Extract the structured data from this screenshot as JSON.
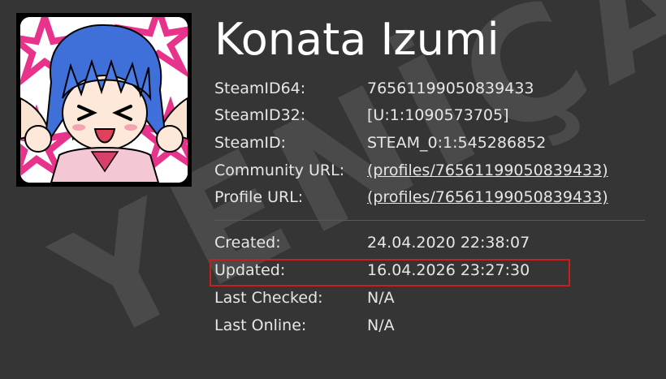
{
  "profile": {
    "name": "Konata Izumi",
    "avatar_description": "anime-avatar"
  },
  "watermark": "YENİÇAĞ",
  "details": [
    {
      "label": "SteamID64:",
      "value": "76561199050839433",
      "link": false
    },
    {
      "label": "SteamID32:",
      "value": "[U:1:1090573705]",
      "link": false
    },
    {
      "label": "SteamID:",
      "value": "STEAM_0:1:545286852",
      "link": false
    },
    {
      "label": "Community URL:",
      "value": "(profiles/76561199050839433)",
      "link": true
    },
    {
      "label": "Profile URL:",
      "value": "(profiles/76561199050839433)",
      "link": true
    }
  ],
  "activity": [
    {
      "label": "Created:",
      "value": "24.04.2020 22:38:07"
    },
    {
      "label": "Updated:",
      "value": "16.04.2026 23:27:30",
      "highlighted": true
    },
    {
      "label": "Last Checked:",
      "value": "N/A"
    },
    {
      "label": "Last Online:",
      "value": "N/A"
    }
  ],
  "colors": {
    "background": "#353535",
    "text": "#e6e6e6",
    "highlight_border": "#c8201d"
  }
}
